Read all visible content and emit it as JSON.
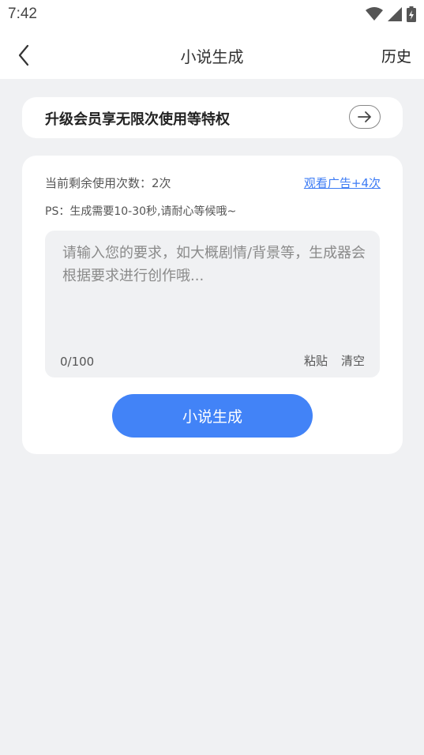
{
  "status_bar": {
    "time": "7:42",
    "icons": [
      "wifi-icon",
      "signal-icon",
      "battery-icon"
    ]
  },
  "header": {
    "title": "小说生成",
    "history_label": "历史"
  },
  "vip_banner": {
    "text": "升级会员享无限次使用等特权"
  },
  "main": {
    "remaining_text": "当前剩余使用次数：2次",
    "watch_ad_label": "观看广告+4次",
    "ps_note": "PS：生成需要10-30秒,请耐心等候哦~",
    "input": {
      "value": "",
      "placeholder": "请输入您的要求，如大概剧情/背景等，生成器会根据要求进行创作哦...",
      "char_count": "0/100"
    },
    "paste_label": "粘贴",
    "clear_label": "清空",
    "generate_label": "小说生成"
  },
  "colors": {
    "accent": "#4283f7",
    "link": "#3d7cf5",
    "background": "#f0f1f3"
  }
}
